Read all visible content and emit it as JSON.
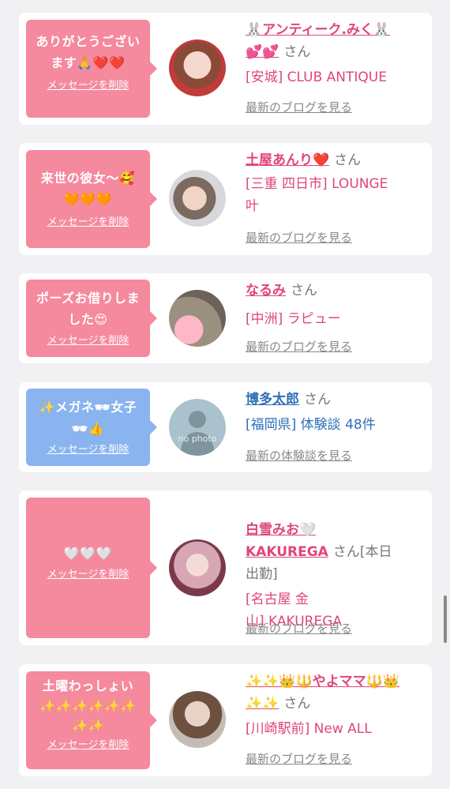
{
  "items": [
    {
      "message": "ありがとうござい\nます🙏❤️❤️",
      "delete_label": "メッセージを削除",
      "name": "🐰アンティーク.みく🐰\n💕💕",
      "san": "さん",
      "shop": "[安城] CLUB ANTIQUE",
      "more": "最新のブログを見る"
    },
    {
      "message": "来世の彼女〜🥰\n🧡🧡🧡",
      "delete_label": "メッセージを削除",
      "name": "土屋あんり❤️",
      "san": "さん",
      "shop": "[三重 四日市] LOUNGE\n叶",
      "more": "最新のブログを見る"
    },
    {
      "message": "ポーズお借りしま\nした😍",
      "delete_label": "メッセージを削除",
      "name": "なるみ",
      "san": "さん",
      "shop": "[中洲] ラピュー",
      "more": "最新のブログを見る"
    },
    {
      "message": "✨メガネ🕶女子\n🕶👍",
      "delete_label": "メッセージを削除",
      "name": "博多太郎",
      "san": "さん",
      "shop": "[福岡県] 体験談 48件",
      "more": "最新の体験談を見る",
      "avatar_text": "no photo"
    },
    {
      "message": "🤍🤍🤍",
      "delete_label": "メッセージを削除",
      "name": "白雪みお🤍\nKAKUREGA",
      "san": "さん[本日\n出勤]",
      "shop": "[名古屋 金\n山] KAKUREGA",
      "more": "最新のブログを見る"
    },
    {
      "message": "土曜わっしょい\n✨✨✨✨✨✨\n✨✨",
      "delete_label": "メッセージを削除",
      "name": "✨✨👑🔱やよママ🔱👑\n✨✨",
      "san": "さん",
      "shop": "[川崎駅前] New ALL",
      "more": "最新のブログを見る"
    }
  ],
  "colors": {
    "pink": "#f5899e",
    "blue": "#8ab4f0",
    "name_pink": "#e0457b",
    "name_blue": "#2d6fb8"
  }
}
